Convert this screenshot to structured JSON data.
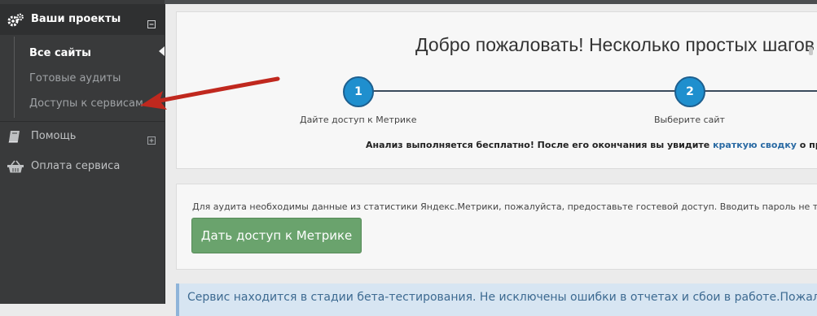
{
  "sidebar": {
    "header": {
      "label": "Ваши проекты",
      "icon": "gears-icon",
      "toggle": "collapse"
    },
    "subitems": [
      {
        "label": "Все сайты",
        "active": true
      },
      {
        "label": "Готовые аудиты",
        "active": false
      },
      {
        "label": "Доступы к сервисам",
        "active": false
      }
    ],
    "items": [
      {
        "label": "Помощь",
        "icon": "book-icon",
        "toggle": "expand"
      },
      {
        "label": "Оплата сервиса",
        "icon": "basket-icon"
      }
    ]
  },
  "welcome": {
    "title": "Добро пожаловать! Несколько простых шагов - и",
    "steps": [
      {
        "number": "1",
        "label": "Дайте доступ к Метрике"
      },
      {
        "number": "2",
        "label": "Выберите сайт"
      }
    ],
    "note_before": "Анализ выполняется бесплатно! После его окончания вы увидите ",
    "note_link": "краткую сводку",
    "note_after": " о пр"
  },
  "audit": {
    "text": "Для аудита необходимы данные из статистики Яндекс.Метрики, пожалуйста, предоставьте гостевой доступ. Вводить пароль не т",
    "button": "Дать доступ к Метрике"
  },
  "info": {
    "text": "Сервис находится в стадии бета-тестирования. Не исключены ошибки в отчетах и сбои в работе.Пожал"
  },
  "colors": {
    "sidebar": "#393a3b",
    "step_circle": "#1f8fce",
    "button": "#6aa36d",
    "annotation_arrow": "#c0281e",
    "link": "#2a6aa3"
  }
}
